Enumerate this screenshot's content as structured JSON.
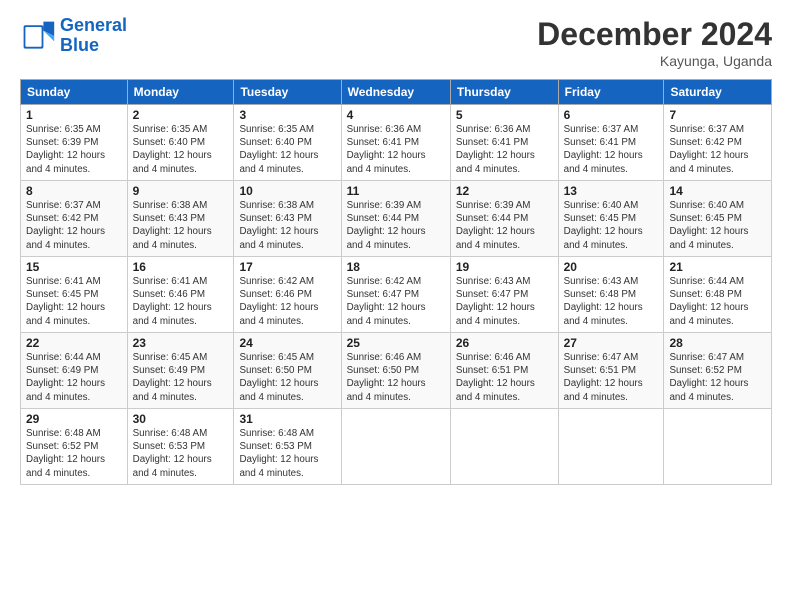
{
  "logo": {
    "line1": "General",
    "line2": "Blue"
  },
  "title": "December 2024",
  "subtitle": "Kayunga, Uganda",
  "days_of_week": [
    "Sunday",
    "Monday",
    "Tuesday",
    "Wednesday",
    "Thursday",
    "Friday",
    "Saturday"
  ],
  "weeks": [
    [
      {
        "num": "1",
        "info": "Sunrise: 6:35 AM\nSunset: 6:39 PM\nDaylight: 12 hours\nand 4 minutes."
      },
      {
        "num": "2",
        "info": "Sunrise: 6:35 AM\nSunset: 6:40 PM\nDaylight: 12 hours\nand 4 minutes."
      },
      {
        "num": "3",
        "info": "Sunrise: 6:35 AM\nSunset: 6:40 PM\nDaylight: 12 hours\nand 4 minutes."
      },
      {
        "num": "4",
        "info": "Sunrise: 6:36 AM\nSunset: 6:41 PM\nDaylight: 12 hours\nand 4 minutes."
      },
      {
        "num": "5",
        "info": "Sunrise: 6:36 AM\nSunset: 6:41 PM\nDaylight: 12 hours\nand 4 minutes."
      },
      {
        "num": "6",
        "info": "Sunrise: 6:37 AM\nSunset: 6:41 PM\nDaylight: 12 hours\nand 4 minutes."
      },
      {
        "num": "7",
        "info": "Sunrise: 6:37 AM\nSunset: 6:42 PM\nDaylight: 12 hours\nand 4 minutes."
      }
    ],
    [
      {
        "num": "8",
        "info": "Sunrise: 6:37 AM\nSunset: 6:42 PM\nDaylight: 12 hours\nand 4 minutes."
      },
      {
        "num": "9",
        "info": "Sunrise: 6:38 AM\nSunset: 6:43 PM\nDaylight: 12 hours\nand 4 minutes."
      },
      {
        "num": "10",
        "info": "Sunrise: 6:38 AM\nSunset: 6:43 PM\nDaylight: 12 hours\nand 4 minutes."
      },
      {
        "num": "11",
        "info": "Sunrise: 6:39 AM\nSunset: 6:44 PM\nDaylight: 12 hours\nand 4 minutes."
      },
      {
        "num": "12",
        "info": "Sunrise: 6:39 AM\nSunset: 6:44 PM\nDaylight: 12 hours\nand 4 minutes."
      },
      {
        "num": "13",
        "info": "Sunrise: 6:40 AM\nSunset: 6:45 PM\nDaylight: 12 hours\nand 4 minutes."
      },
      {
        "num": "14",
        "info": "Sunrise: 6:40 AM\nSunset: 6:45 PM\nDaylight: 12 hours\nand 4 minutes."
      }
    ],
    [
      {
        "num": "15",
        "info": "Sunrise: 6:41 AM\nSunset: 6:45 PM\nDaylight: 12 hours\nand 4 minutes."
      },
      {
        "num": "16",
        "info": "Sunrise: 6:41 AM\nSunset: 6:46 PM\nDaylight: 12 hours\nand 4 minutes."
      },
      {
        "num": "17",
        "info": "Sunrise: 6:42 AM\nSunset: 6:46 PM\nDaylight: 12 hours\nand 4 minutes."
      },
      {
        "num": "18",
        "info": "Sunrise: 6:42 AM\nSunset: 6:47 PM\nDaylight: 12 hours\nand 4 minutes."
      },
      {
        "num": "19",
        "info": "Sunrise: 6:43 AM\nSunset: 6:47 PM\nDaylight: 12 hours\nand 4 minutes."
      },
      {
        "num": "20",
        "info": "Sunrise: 6:43 AM\nSunset: 6:48 PM\nDaylight: 12 hours\nand 4 minutes."
      },
      {
        "num": "21",
        "info": "Sunrise: 6:44 AM\nSunset: 6:48 PM\nDaylight: 12 hours\nand 4 minutes."
      }
    ],
    [
      {
        "num": "22",
        "info": "Sunrise: 6:44 AM\nSunset: 6:49 PM\nDaylight: 12 hours\nand 4 minutes."
      },
      {
        "num": "23",
        "info": "Sunrise: 6:45 AM\nSunset: 6:49 PM\nDaylight: 12 hours\nand 4 minutes."
      },
      {
        "num": "24",
        "info": "Sunrise: 6:45 AM\nSunset: 6:50 PM\nDaylight: 12 hours\nand 4 minutes."
      },
      {
        "num": "25",
        "info": "Sunrise: 6:46 AM\nSunset: 6:50 PM\nDaylight: 12 hours\nand 4 minutes."
      },
      {
        "num": "26",
        "info": "Sunrise: 6:46 AM\nSunset: 6:51 PM\nDaylight: 12 hours\nand 4 minutes."
      },
      {
        "num": "27",
        "info": "Sunrise: 6:47 AM\nSunset: 6:51 PM\nDaylight: 12 hours\nand 4 minutes."
      },
      {
        "num": "28",
        "info": "Sunrise: 6:47 AM\nSunset: 6:52 PM\nDaylight: 12 hours\nand 4 minutes."
      }
    ],
    [
      {
        "num": "29",
        "info": "Sunrise: 6:48 AM\nSunset: 6:52 PM\nDaylight: 12 hours\nand 4 minutes."
      },
      {
        "num": "30",
        "info": "Sunrise: 6:48 AM\nSunset: 6:53 PM\nDaylight: 12 hours\nand 4 minutes."
      },
      {
        "num": "31",
        "info": "Sunrise: 6:48 AM\nSunset: 6:53 PM\nDaylight: 12 hours\nand 4 minutes."
      },
      null,
      null,
      null,
      null
    ]
  ]
}
